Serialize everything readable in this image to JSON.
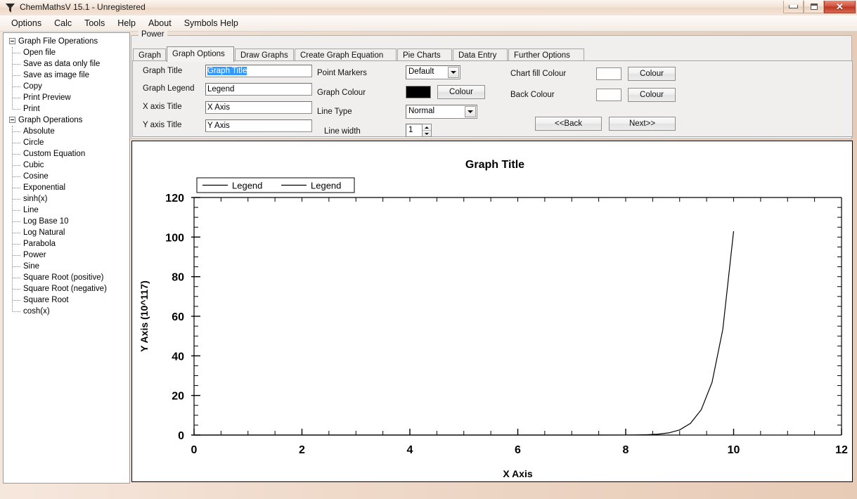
{
  "window": {
    "title": "ChemMathsV 15.1 - Unregistered",
    "icon": "funnel-icon",
    "buttons": {
      "minimize": "minimize-icon",
      "maximize": "maximize-icon",
      "close": "✕"
    }
  },
  "menubar": {
    "items": [
      {
        "label": "Options"
      },
      {
        "label": "Calc"
      },
      {
        "label": "Tools"
      },
      {
        "label": "Help"
      },
      {
        "label": "About"
      },
      {
        "label": "Symbols Help"
      }
    ]
  },
  "tree": {
    "groups": [
      {
        "label": "Graph File Operations",
        "children": [
          "Open file",
          "Save as data only file",
          "Save as image file",
          "Copy",
          "Print Preview",
          "Print"
        ]
      },
      {
        "label": "Graph Operations",
        "children": [
          "Absolute",
          "Circle",
          "Custom Equation",
          "Cubic",
          "Cosine",
          "Exponential",
          "sinh(x)",
          "Line",
          "Log Base 10",
          "Log Natural",
          "Parabola",
          "Power",
          "Sine",
          "Square Root (positive)",
          "Square Root (negative)",
          "Square Root",
          "cosh(x)"
        ]
      }
    ]
  },
  "groupbox": {
    "title": "Power"
  },
  "tabs": [
    {
      "label": "Graph",
      "selected": false
    },
    {
      "label": "Graph Options",
      "selected": true
    },
    {
      "label": "Draw Graphs",
      "selected": false
    },
    {
      "label": "Create Graph Equation",
      "selected": false
    },
    {
      "label": "Pie Charts",
      "selected": false
    },
    {
      "label": "Data Entry",
      "selected": false
    },
    {
      "label": "Further Options",
      "selected": false
    }
  ],
  "form": {
    "graph_title_label": "Graph Title",
    "graph_title_value": "Graph Title",
    "graph_legend_label": "Graph Legend",
    "graph_legend_value": "Legend",
    "x_axis_title_label": "X axis Title",
    "x_axis_title_value": "X Axis",
    "y_axis_title_label": "Y axis Title",
    "y_axis_title_value": "Y Axis",
    "point_markers_label": "Point Markers",
    "point_markers_value": "Default",
    "graph_colour_label": "Graph Colour",
    "graph_colour_value": "#000000",
    "graph_colour_button": "Colour",
    "line_type_label": "Line Type",
    "line_type_value": "Normal",
    "line_width_label": "Line width",
    "line_width_value": "1",
    "chart_fill_colour_label": "Chart fill Colour",
    "chart_fill_colour_value": "#ffffff",
    "chart_fill_colour_button": "Colour",
    "back_colour_label": "Back Colour",
    "back_colour_value": "#ffffff",
    "back_colour_button": "Colour",
    "back_button": "<<Back",
    "next_button": "Next>>"
  },
  "chart_data": {
    "type": "line",
    "title": "Graph Title",
    "xlabel": "X Axis",
    "ylabel": "Y Axis (10^117)",
    "xlim": [
      0,
      12
    ],
    "ylim": [
      0,
      120
    ],
    "xticks": [
      0,
      2,
      4,
      6,
      8,
      10,
      12
    ],
    "yticks": [
      0,
      20,
      40,
      60,
      80,
      100,
      120
    ],
    "x_minor_step": 0.5,
    "y_minor_step": 5,
    "grid": false,
    "legend_position": "top-left",
    "legend": [
      "Legend",
      "Legend"
    ],
    "line_colour": "#000000",
    "line_width": 1,
    "series": [
      {
        "name": "Legend",
        "x": [
          0.0,
          0.5,
          1.0,
          1.5,
          2.0,
          2.5,
          3.0,
          3.5,
          4.0,
          4.5,
          5.0,
          5.5,
          6.0,
          6.5,
          7.0,
          7.5,
          8.0,
          8.2,
          8.4,
          8.6,
          8.8,
          9.0,
          9.2,
          9.4,
          9.6,
          9.8,
          10.0
        ],
        "y": [
          0,
          0,
          0,
          0,
          0,
          0,
          0,
          0,
          0,
          0,
          0,
          0,
          0,
          0,
          0,
          0,
          0.02,
          0.06,
          0.17,
          0.45,
          1.1,
          2.6,
          5.9,
          12.8,
          26.6,
          53.4,
          103.0
        ]
      }
    ]
  }
}
